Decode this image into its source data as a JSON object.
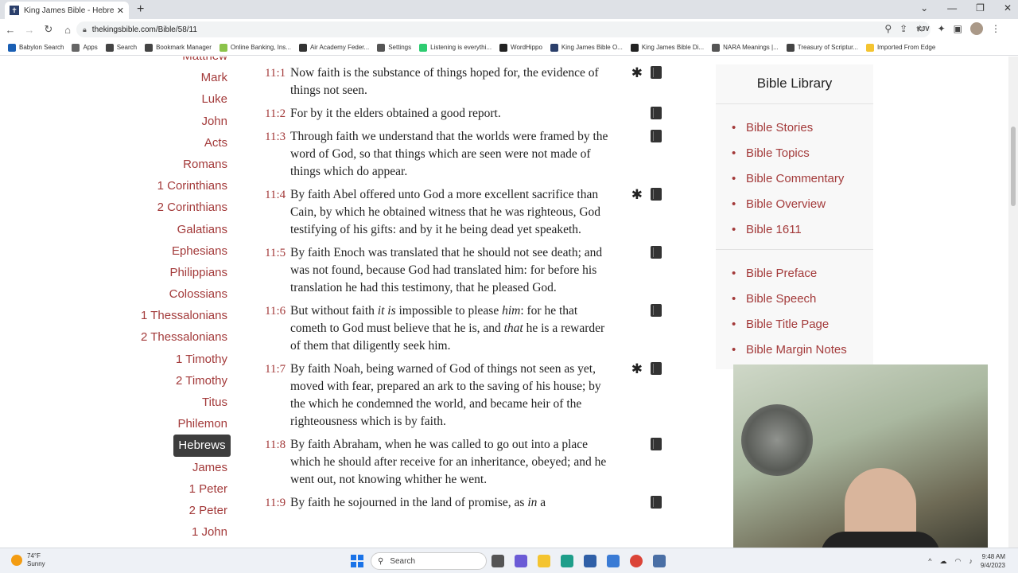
{
  "browser": {
    "tab_title": "King James Bible - Hebrews <sp...",
    "tab_favicon": "✝",
    "tab_close": "✕",
    "new_tab": "+",
    "url": "thekingsbible.com/Bible/58/11",
    "window_controls": [
      "⌄",
      "—",
      "❐",
      "✕"
    ]
  },
  "bookmarks": [
    {
      "label": "Babylon Search",
      "color": "#1a5fb4"
    },
    {
      "label": "Apps",
      "color": "#666666"
    },
    {
      "label": "Search",
      "color": "#444444"
    },
    {
      "label": "Bookmark Manager",
      "color": "#444444"
    },
    {
      "label": "Online Banking, Ins...",
      "color": "#8bc34a"
    },
    {
      "label": "Air Academy Feder...",
      "color": "#333333"
    },
    {
      "label": "Settings",
      "color": "#555555"
    },
    {
      "label": "Listening is everythi...",
      "color": "#2ecc71"
    },
    {
      "label": "WordHippo",
      "color": "#222222"
    },
    {
      "label": "King James Bible O...",
      "color": "#2b3f6b"
    },
    {
      "label": "King James Bible Di...",
      "color": "#222222"
    },
    {
      "label": "NARA Meanings |...",
      "color": "#555555"
    },
    {
      "label": "Treasury of Scriptur...",
      "color": "#444444"
    },
    {
      "label": "Imported From Edge",
      "color": "#f4c430"
    }
  ],
  "books": [
    "Matthew",
    "Mark",
    "Luke",
    "John",
    "Acts",
    "Romans",
    "1 Corinthians",
    "2 Corinthians",
    "Galatians",
    "Ephesians",
    "Philippians",
    "Colossians",
    "1 Thessalonians",
    "2 Thessalonians",
    "1 Timothy",
    "2 Timothy",
    "Titus",
    "Philemon",
    "Hebrews",
    "James",
    "1 Peter",
    "2 Peter",
    "1 John"
  ],
  "active_book": "Hebrews",
  "verses": [
    {
      "ref": "11:1",
      "star": true,
      "html": "Now faith is the substance of things hoped for, the evidence of things not seen."
    },
    {
      "ref": "11:2",
      "star": false,
      "html": "For by it the elders obtained a good report."
    },
    {
      "ref": "11:3",
      "star": false,
      "html": "Through faith we understand that the worlds were framed by the word of God, so that things which are seen were not made of things which do appear."
    },
    {
      "ref": "11:4",
      "star": true,
      "html": "By faith Abel offered unto God a more excellent sacrifice than Cain, by which he obtained witness that he was righteous, God testifying of his gifts: and by it he being dead yet speaketh."
    },
    {
      "ref": "11:5",
      "star": false,
      "html": "By faith Enoch was translated that he should not see death; and was not found, because God had translated him: for before his translation he had this testimony, that he pleased God."
    },
    {
      "ref": "11:6",
      "star": false,
      "html": "But without faith <i>it is</i> impossible to please <i>him</i>: for he that cometh to God must believe that he is, and <i>that</i> he is a rewarder of them that diligently seek him."
    },
    {
      "ref": "11:7",
      "star": true,
      "html": "By faith Noah, being warned of God of things not seen as yet, moved with fear, prepared an ark to the saving of his house; by the which he condemned the world, and became heir of the righteousness which is by faith."
    },
    {
      "ref": "11:8",
      "star": false,
      "html": "By faith Abraham, when he was called to go out into a place which he should after receive for an inheritance, obeyed; and he went out, not knowing whither he went."
    },
    {
      "ref": "11:9",
      "star": false,
      "html": "By faith he sojourned in the land of promise, as <i>in</i> a"
    }
  ],
  "sidebar": {
    "title": "Bible Library",
    "group1": [
      "Bible Stories",
      "Bible Topics",
      "Bible Commentary",
      "Bible Overview",
      "Bible 1611"
    ],
    "group2": [
      "Bible Preface",
      "Bible Speech",
      "Bible Title Page",
      "Bible Margin Notes"
    ]
  },
  "taskbar": {
    "temp": "74°F",
    "condition": "Sunny",
    "search_placeholder": "Search",
    "time": "9:48 AM",
    "date": "9/4/2023"
  },
  "colors": {
    "accent_red": "#a33a3a",
    "active_book_bg": "#3d3d3d"
  }
}
